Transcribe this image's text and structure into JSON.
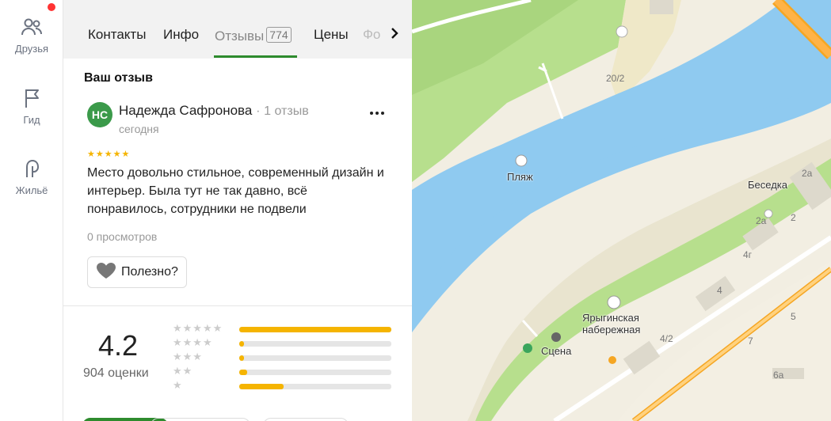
{
  "sidebar": {
    "items": [
      {
        "label": "Друзья",
        "icon": "friends-icon"
      },
      {
        "label": "Гид",
        "icon": "flag-icon"
      },
      {
        "label": "Жильё",
        "icon": "housing-icon"
      }
    ]
  },
  "tabs": {
    "items": [
      "Контакты",
      "Инфо",
      "Отзывы",
      "Цены"
    ],
    "reviews_count": "774",
    "faded": "Фо",
    "active": "Отзывы"
  },
  "review": {
    "section_title": "Ваш отзыв",
    "avatar_initials": "НС",
    "author": "Надежда Сафронова",
    "separator": "·",
    "author_reviews": "1 отзыв",
    "date": "сегодня",
    "stars": "★★★★★",
    "text": "Место довольно стильное, современный дизайн и интерьер. Была тут не так давно, всё понравилось, сотрудники не подвели",
    "views": "0 просмотров",
    "helpful_label": "Полезно?"
  },
  "rating": {
    "value": "4.2",
    "count": "904 оценки",
    "distribution": [
      {
        "stars": "★★★★★",
        "fraction": 1.0
      },
      {
        "stars": "★★★★",
        "fraction": 0.03
      },
      {
        "stars": "★★★",
        "fraction": 0.03
      },
      {
        "stars": "★★",
        "fraction": 0.05
      },
      {
        "stars": "★",
        "fraction": 0.29
      }
    ]
  },
  "map": {
    "labels": {
      "beach": "Пляж",
      "gazebo": "Беседка",
      "embankment_1": "Ярыгинская",
      "embankment_2": "набережная",
      "stage": "Сцена"
    },
    "house_numbers": [
      "20/2",
      "2а",
      "2а",
      "2",
      "4г",
      "4",
      "4/2",
      "5",
      "7",
      "6а"
    ]
  },
  "colors": {
    "water": "#8fcaf0",
    "park": "#b7df8d",
    "land": "#f3efe3",
    "road": "#ffffff",
    "highway": "#f5a623",
    "accent_green": "#2e8b2e",
    "star": "#f5b400"
  }
}
